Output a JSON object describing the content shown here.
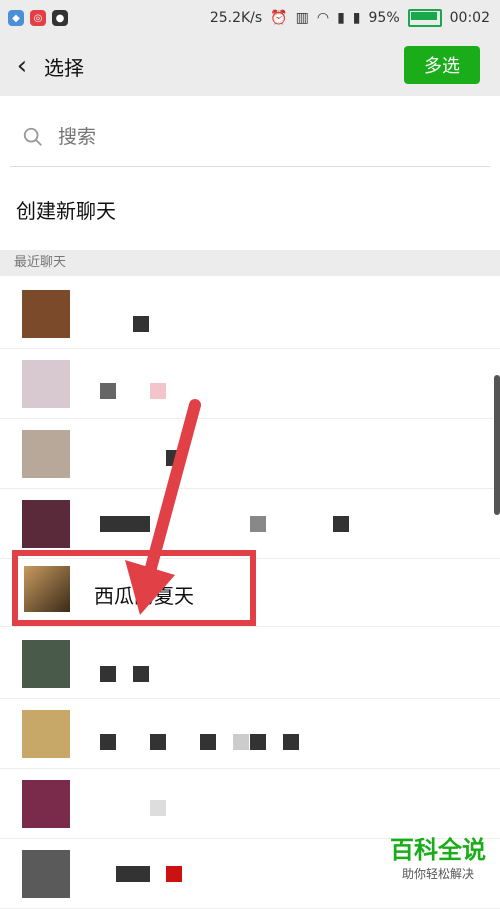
{
  "status": {
    "speed": "25.2K/s",
    "battery": "95%",
    "battery_level": 0.95,
    "time": "00:02"
  },
  "header": {
    "title": "选择",
    "multi_label": "多选"
  },
  "search": {
    "placeholder": "搜索"
  },
  "create_chat": "创建新聊天",
  "section_label": "最近聊天",
  "highlighted_chat": "西瓜的夏天",
  "watermark": {
    "title": "百科全说",
    "subtitle": "助你轻松解决"
  },
  "colors": {
    "accent": "#1aad19",
    "highlight": "#e04046"
  }
}
